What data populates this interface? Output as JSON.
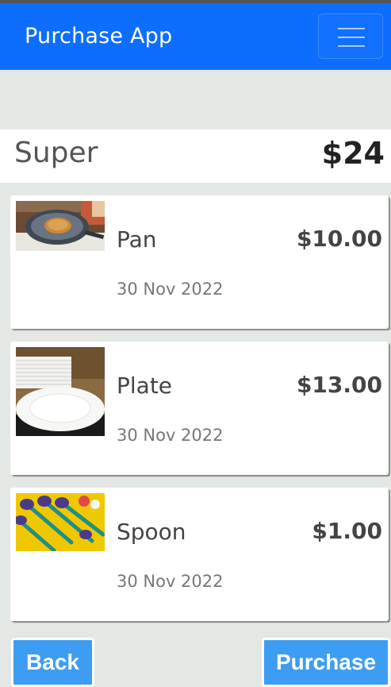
{
  "navbar": {
    "brand": "Purchase App",
    "menu_icon": "hamburger-menu-icon",
    "color": "#0d6efd"
  },
  "summary": {
    "store": "Super",
    "total": "$24"
  },
  "items": [
    {
      "name": "Pan",
      "price": "$10.00",
      "date": "30 Nov 2022",
      "image": "pan-with-pancake-photo"
    },
    {
      "name": "Plate",
      "price": "$13.00",
      "date": "30 Nov 2022",
      "image": "white-plates-photo"
    },
    {
      "name": "Spoon",
      "price": "$1.00",
      "date": "30 Nov 2022",
      "image": "colorful-spoons-photo"
    }
  ],
  "buttons": {
    "back": "Back",
    "purchase": "Purchase",
    "color": "#3d9df2"
  }
}
